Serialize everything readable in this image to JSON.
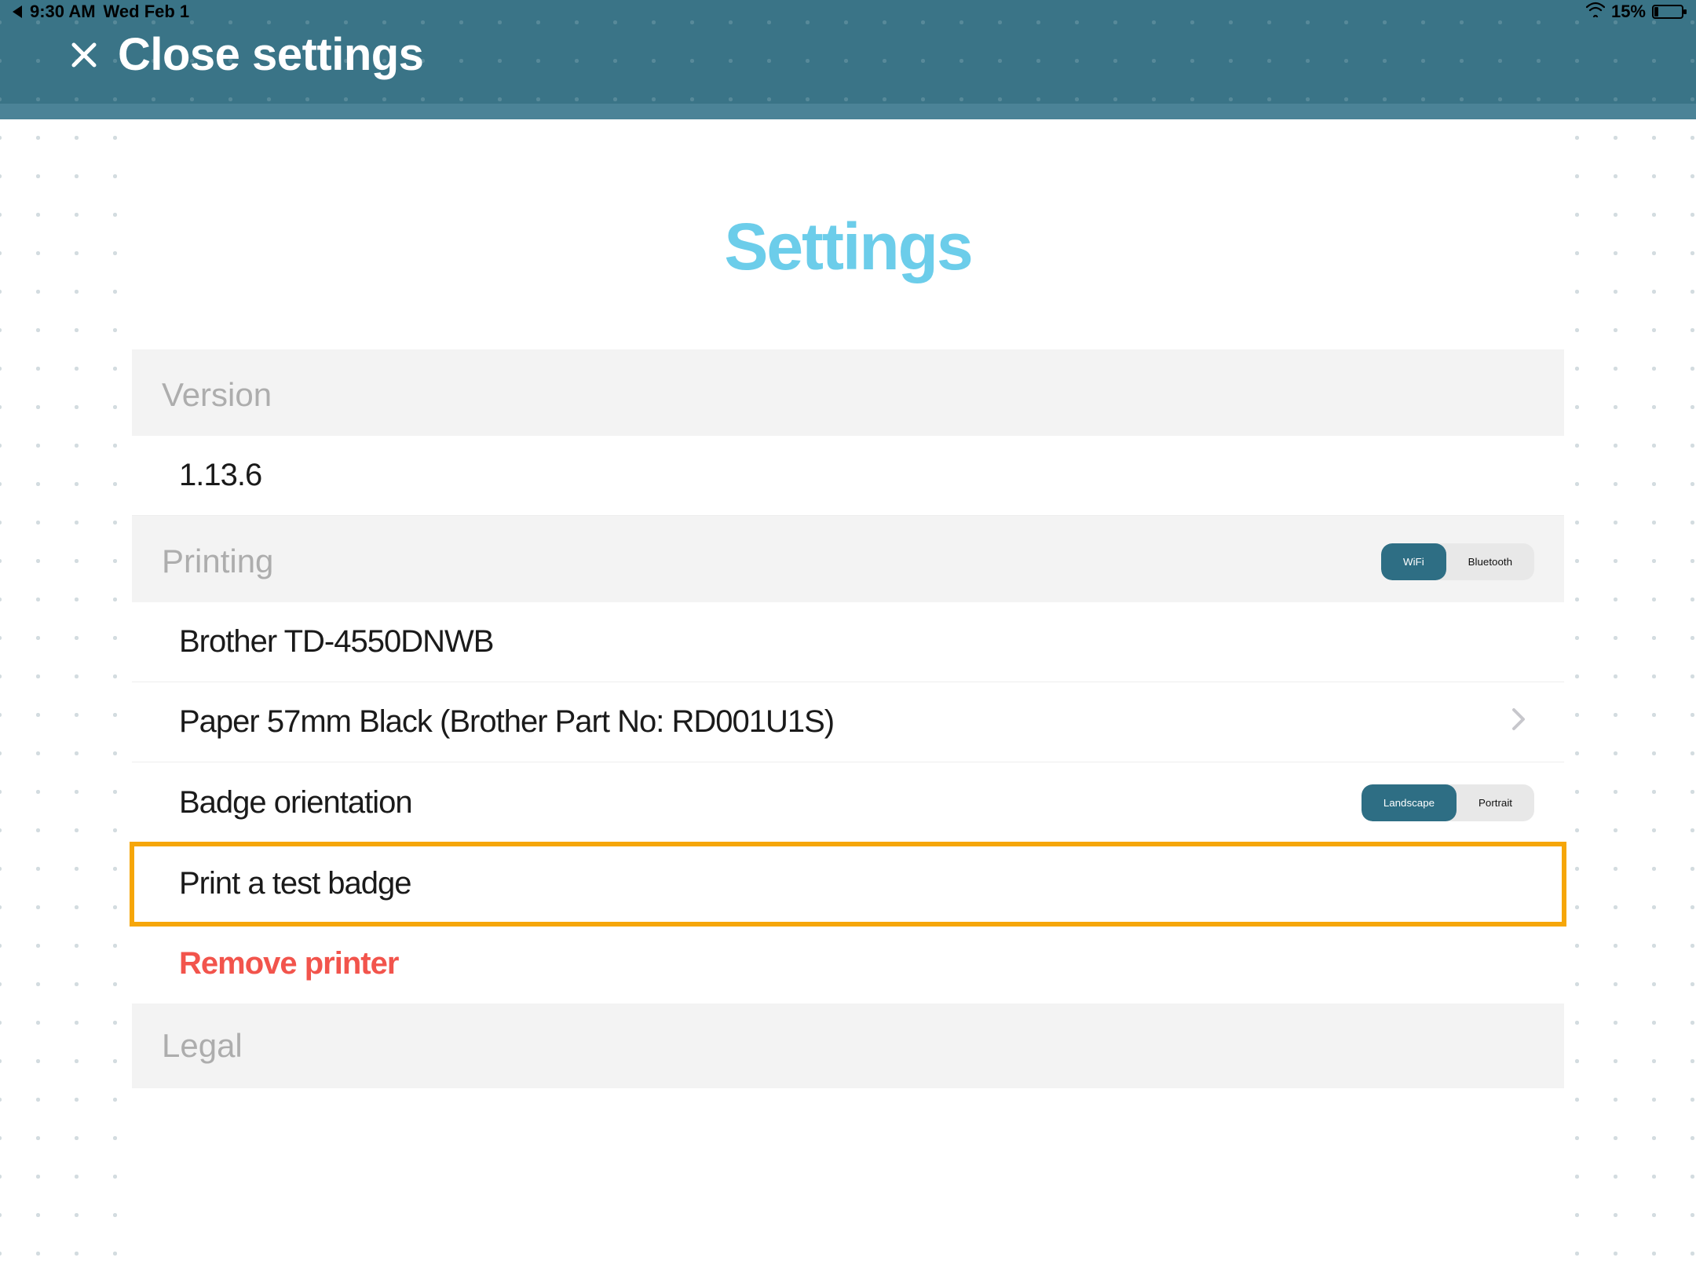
{
  "status": {
    "time": "9:30 AM",
    "date": "Wed Feb 1",
    "battery_percent": "15%"
  },
  "header": {
    "close_label": "Close settings"
  },
  "page": {
    "title": "Settings"
  },
  "sections": {
    "version": {
      "label": "Version",
      "value": "1.13.6"
    },
    "printing": {
      "label": "Printing",
      "mode_options": [
        "WiFi",
        "Bluetooth"
      ],
      "mode_selected": "WiFi",
      "printer_name": "Brother TD-4550DNWB",
      "paper": "Paper 57mm Black (Brother Part No: RD001U1S)",
      "orientation_label": "Badge orientation",
      "orientation_options": [
        "Landscape",
        "Portrait"
      ],
      "orientation_selected": "Landscape",
      "test_badge_label": "Print a test badge",
      "remove_printer_label": "Remove printer"
    },
    "legal": {
      "label": "Legal"
    }
  },
  "colors": {
    "header_bg": "#3a7487",
    "header_sub": "#4b8397",
    "title_accent": "#6ccdea",
    "danger": "#f2544c",
    "highlight": "#f6a609",
    "segment_active": "#2e6e84",
    "segment_bg": "#e8e8e8",
    "section_header_bg": "#f3f3f3"
  }
}
